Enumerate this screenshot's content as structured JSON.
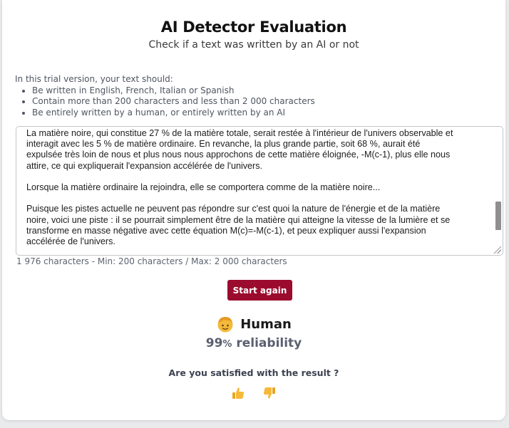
{
  "header": {
    "title": "AI Detector Evaluation",
    "subtitle": "Check if a text was written by an AI or not"
  },
  "requirements": {
    "intro": "In this trial version, your text should:",
    "items": [
      "Be written in English, French, Italian or Spanish",
      "Contain more than 200 characters and less than 2 000 characters",
      "Be entirely written by a human, or entirely written by an AI"
    ]
  },
  "text_input": {
    "value": "La matière noire, qui constitue 27 % de la matière totale, serait restée à l'intérieur de l'univers observable et\ninteragit avec les 5 % de matière ordinaire. En revanche, la plus grande partie, soit 68 %, aurait été\nexpulsée très loin de nous et plus nous nous approchons de cette matière éloignée, -M(c-1), plus elle nous\nattire, ce qui expliquerait l'expansion accélérée de l'univers.\n\nLorsque la matière ordinaire la rejoindra, elle se comportera comme de la matière noire...\n\nPuisque les pistes actuelle ne peuvent pas répondre sur c'est quoi la nature de l'énergie et de la matière\nnoire, voici une piste : il se pourrait simplement être de la matière qui atteigne la vitesse de la lumière et se\ntransforme en masse négative avec cette équation M(c)=-M(c-1), et peux expliquer aussi l'expansion\naccélérée de l'univers."
  },
  "counter": "1 976 characters - Min: 200 characters / Max: 2 000 characters",
  "start_button": "Start again",
  "result": {
    "label": "Human",
    "reliability_value": "99",
    "reliability_pct": "%",
    "reliability_text": " reliability",
    "icon": "human-face-icon"
  },
  "feedback": {
    "question": "Are you satisfied with the result ?",
    "thumbs_up_icon": "thumbs-up-icon",
    "thumbs_down_icon": "thumbs-down-icon"
  },
  "colors": {
    "accent": "#9b0b2e",
    "emoji": "#f5b93a"
  }
}
